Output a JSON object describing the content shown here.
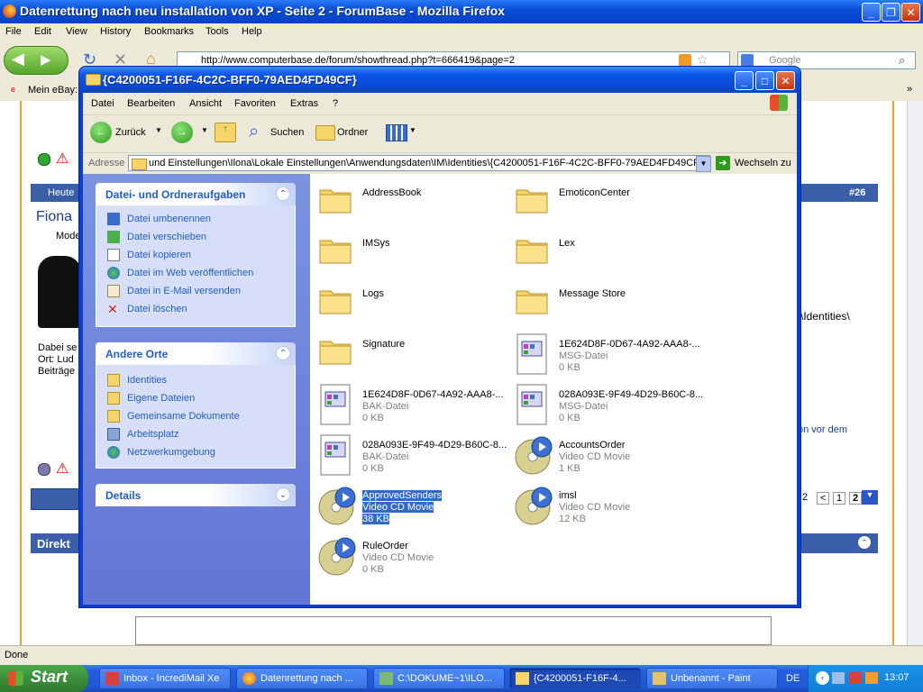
{
  "firefox": {
    "title": "Datenrettung nach neu installation von XP - Seite 2 - ForumBase - Mozilla Firefox",
    "menu": [
      "File",
      "Edit",
      "View",
      "History",
      "Bookmarks",
      "Tools",
      "Help"
    ],
    "url": "http://www.computerbase.de/forum/showthread.php?t=666419&page=2",
    "search_placeholder": "Google",
    "bookmark": "Mein eBay:",
    "status": "Done"
  },
  "forum_bg": {
    "post_header_left": "Heute",
    "post_number": "#26",
    "user_name": "Fiona",
    "user_role": "Mode",
    "info_lines": [
      "Dabei se",
      "Ort: Lud",
      "Beiträge"
    ],
    "right_snippet_1": "\\Identities\\",
    "right_snippet_2": "on vor dem",
    "pagination": [
      "2",
      "<",
      "1",
      "2"
    ],
    "quick_reply": "Direkt"
  },
  "explorer": {
    "title": "{C4200051-F16F-4C2C-BFF0-79AED4FD49CF}",
    "menu": [
      "Datei",
      "Bearbeiten",
      "Ansicht",
      "Favoriten",
      "Extras",
      "?"
    ],
    "toolbar": {
      "back": "Zurück",
      "search": "Suchen",
      "folders": "Ordner"
    },
    "address_label": "Adresse",
    "address_path": "und Einstellungen\\Ilona\\Lokale Einstellungen\\Anwendungsdaten\\IM\\Identities\\{C4200051-F16F-4C2C-BFF0-79AED4FD49CF}",
    "go_label": "Wechseln zu",
    "panels": {
      "tasks_title": "Datei- und Ordneraufgaben",
      "tasks": [
        "Datei umbenennen",
        "Datei verschieben",
        "Datei kopieren",
        "Datei im Web veröffentlichen",
        "Datei in E-Mail versenden",
        "Datei löschen"
      ],
      "places_title": "Andere Orte",
      "places": [
        "Identities",
        "Eigene Dateien",
        "Gemeinsame Dokumente",
        "Arbeitsplatz",
        "Netzwerkumgebung"
      ],
      "details_title": "Details"
    },
    "files": [
      {
        "name": "AddressBook",
        "type": "",
        "size": "",
        "icon": "folder"
      },
      {
        "name": "EmoticonCenter",
        "type": "",
        "size": "",
        "icon": "folder"
      },
      {
        "name": "IMSys",
        "type": "",
        "size": "",
        "icon": "folder"
      },
      {
        "name": "Lex",
        "type": "",
        "size": "",
        "icon": "folder"
      },
      {
        "name": "Logs",
        "type": "",
        "size": "",
        "icon": "folder"
      },
      {
        "name": "Message Store",
        "type": "",
        "size": "",
        "icon": "folder"
      },
      {
        "name": "Signature",
        "type": "",
        "size": "",
        "icon": "folder"
      },
      {
        "name": "1E624D8F-0D67-4A92-AAA8-...",
        "type": "MSG-Datei",
        "size": "0 KB",
        "icon": "file"
      },
      {
        "name": "1E624D8F-0D67-4A92-AAA8-...",
        "type": "BAK-Datei",
        "size": "0 KB",
        "icon": "file"
      },
      {
        "name": "028A093E-9F49-4D29-B60C-8...",
        "type": "MSG-Datei",
        "size": "0 KB",
        "icon": "file"
      },
      {
        "name": "028A093E-9F49-4D29-B60C-8...",
        "type": "BAK-Datei",
        "size": "0 KB",
        "icon": "file"
      },
      {
        "name": "AccountsOrder",
        "type": "Video CD Movie",
        "size": "1 KB",
        "icon": "cd"
      },
      {
        "name": "ApprovedSenders",
        "type": "Video CD Movie",
        "size": "38 KB",
        "icon": "cd",
        "selected": true
      },
      {
        "name": "imsl",
        "type": "Video CD Movie",
        "size": "12 KB",
        "icon": "cd"
      },
      {
        "name": "RuleOrder",
        "type": "Video CD Movie",
        "size": "0 KB",
        "icon": "cd"
      }
    ]
  },
  "taskbar": {
    "start": "Start",
    "items": [
      "Inbox - IncrediMail Xe",
      "Datenrettung nach ...",
      "C:\\DOKUME~1\\ILO...",
      "{C4200051-F16F-4...",
      "Unbenannt - Paint"
    ],
    "lang": "DE",
    "clock": "13:07"
  }
}
